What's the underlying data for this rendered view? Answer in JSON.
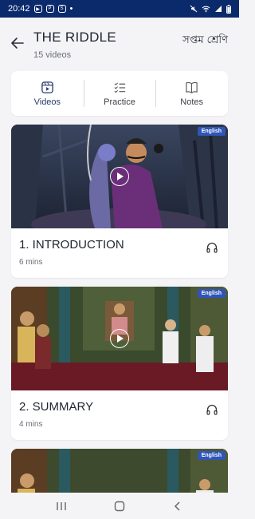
{
  "status_bar": {
    "time": "20:42",
    "left_icons": [
      "app-icon-1",
      "app-icon-2",
      "app-icon-3"
    ],
    "right_icons": [
      "mute-icon",
      "wifi-icon",
      "signal-icon",
      "battery-icon"
    ]
  },
  "header": {
    "title": "THE RIDDLE",
    "subtitle": "15 videos",
    "class_label": "সপ্তম শ্রেণি"
  },
  "tabs": [
    {
      "label": "Videos",
      "icon": "video-icon",
      "active": true
    },
    {
      "label": "Practice",
      "icon": "checklist-icon",
      "active": false
    },
    {
      "label": "Notes",
      "icon": "book-icon",
      "active": false
    }
  ],
  "videos": [
    {
      "badge": "English",
      "title": "1. INTRODUCTION",
      "duration": "6 mins",
      "icon": "headphones-icon"
    },
    {
      "badge": "English",
      "title": "2. SUMMARY",
      "duration": "4 mins",
      "icon": "headphones-icon"
    },
    {
      "badge": "English",
      "title": "",
      "duration": "",
      "icon": ""
    }
  ],
  "colors": {
    "status_bar": "#0b2a6b",
    "badge": "#2f55b8",
    "background": "#f4f4f6"
  }
}
